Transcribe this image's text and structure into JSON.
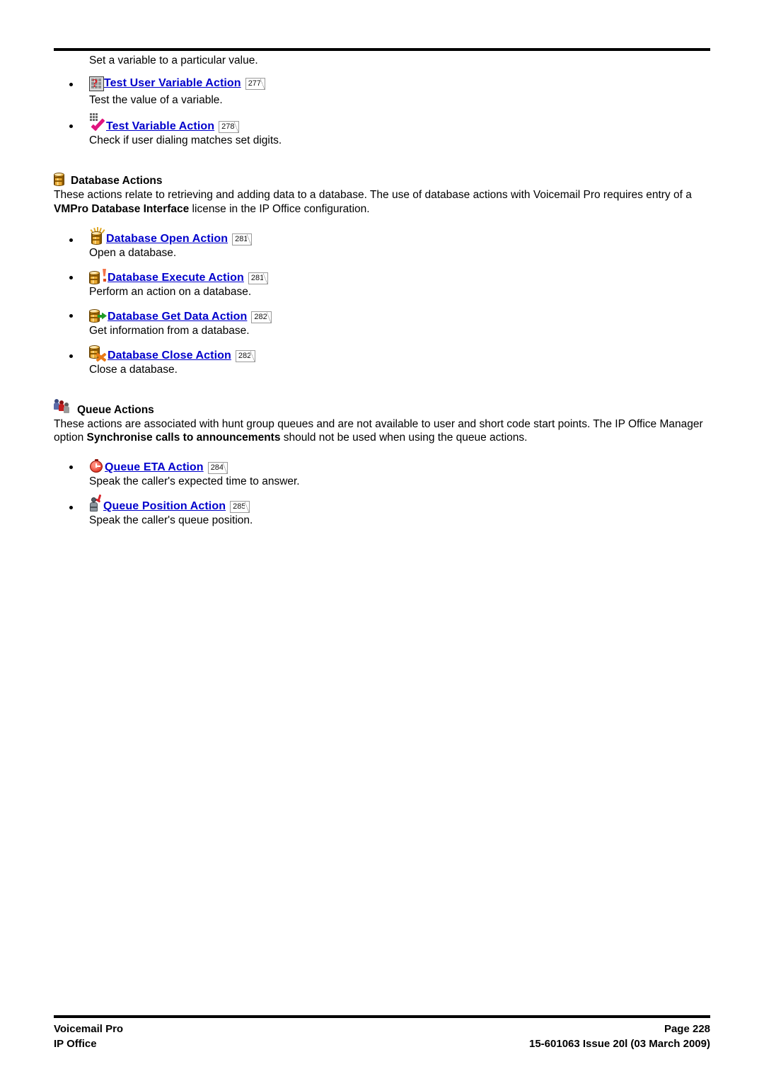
{
  "document": {
    "intro_line": "Set a variable to a particular value."
  },
  "top_items": [
    {
      "icon": "keypad-question-icon",
      "label": "Test User Variable Action",
      "pageref": "277",
      "desc": "Test the value of a variable."
    },
    {
      "icon": "keypad-check-icon",
      "label": "Test Variable Action",
      "pageref": "278",
      "desc": "Check if user dialing matches set digits."
    }
  ],
  "database_section": {
    "icon": "database-icon",
    "title": "Database Actions",
    "body_part1": "These actions relate to retrieving and adding data to a database. The use of database actions with Voicemail Pro requires entry of a ",
    "body_bold": "VMPro Database Interface",
    "body_part2": " license in the IP Office configuration.",
    "items": [
      {
        "icon": "database-open-icon",
        "label": "Database Open Action",
        "pageref": "281",
        "desc": "Open a database."
      },
      {
        "icon": "database-execute-icon",
        "label": "Database Execute Action",
        "pageref": "281",
        "desc": "Perform an action on a database."
      },
      {
        "icon": "database-get-data-icon",
        "label": "Database Get Data Action",
        "pageref": "282",
        "desc": "Get information from a database."
      },
      {
        "icon": "database-close-icon",
        "label": "Database Close Action",
        "pageref": "282",
        "desc": "Close a database."
      }
    ]
  },
  "queue_section": {
    "icon": "queue-people-icon",
    "title": "Queue Actions",
    "body_part1": "These actions are associated with hunt group queues and are not available to user and short code start points. The IP Office Manager option ",
    "body_bold": "Synchronise calls to announcements",
    "body_part2": " should not be used when using the queue actions.",
    "items": [
      {
        "icon": "queue-eta-clock-icon",
        "label": "Queue ETA Action",
        "pageref": "284",
        "desc": "Speak the caller's expected time to answer."
      },
      {
        "icon": "queue-position-icon",
        "label": "Queue Position Action",
        "pageref": "285",
        "desc": "Speak the caller's queue position."
      }
    ]
  },
  "footer": {
    "product": "Voicemail Pro",
    "family": "IP Office",
    "page": "Page 228",
    "issue": "15-601063 Issue 20l (03 March 2009)"
  },
  "colors": {
    "link": "#0000CC",
    "database_gold": "#E8A832",
    "accent_red": "#D8232A",
    "accent_magenta": "#E0157F",
    "accent_green": "#1F9B27",
    "accent_orange": "#E87A18"
  }
}
